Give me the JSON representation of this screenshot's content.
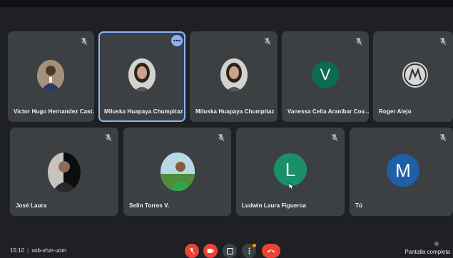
{
  "participants": [
    {
      "name": "Victor Hugo Hernandez Cast...",
      "avatar": "photo-person-suit"
    },
    {
      "name": "Miluska Huapaya Chumpitaz",
      "avatar": "photo-woman",
      "active": true
    },
    {
      "name": "Miluska Huapaya Chumpitaz",
      "avatar": "photo-woman"
    },
    {
      "name": "Vanessa Celia Aranibar Cov...",
      "avatar": "letter",
      "letter": "V",
      "color": "#0b6b4f"
    },
    {
      "name": "Roger Alejo",
      "avatar": "logo-m"
    },
    {
      "name": "José Laura",
      "avatar": "photo-man"
    },
    {
      "name": "Selin Torres V.",
      "avatar": "photo-outdoor"
    },
    {
      "name": "Ludwin Laura Figueroa",
      "avatar": "letter",
      "letter": "L",
      "color": "#1a8f6a"
    },
    {
      "name": "Tú",
      "avatar": "letter",
      "letter": "M",
      "color": "#1e5fa8"
    }
  ],
  "meeting": {
    "time": "15:10",
    "code": "xob-vhzr-uom"
  },
  "footer": {
    "fullscreen_label": "Pantalla completa"
  },
  "colors": {
    "tile": "#3c4043",
    "background": "#1e2023",
    "hangup": "#ea4335",
    "active_border": "#8ab4f8"
  }
}
